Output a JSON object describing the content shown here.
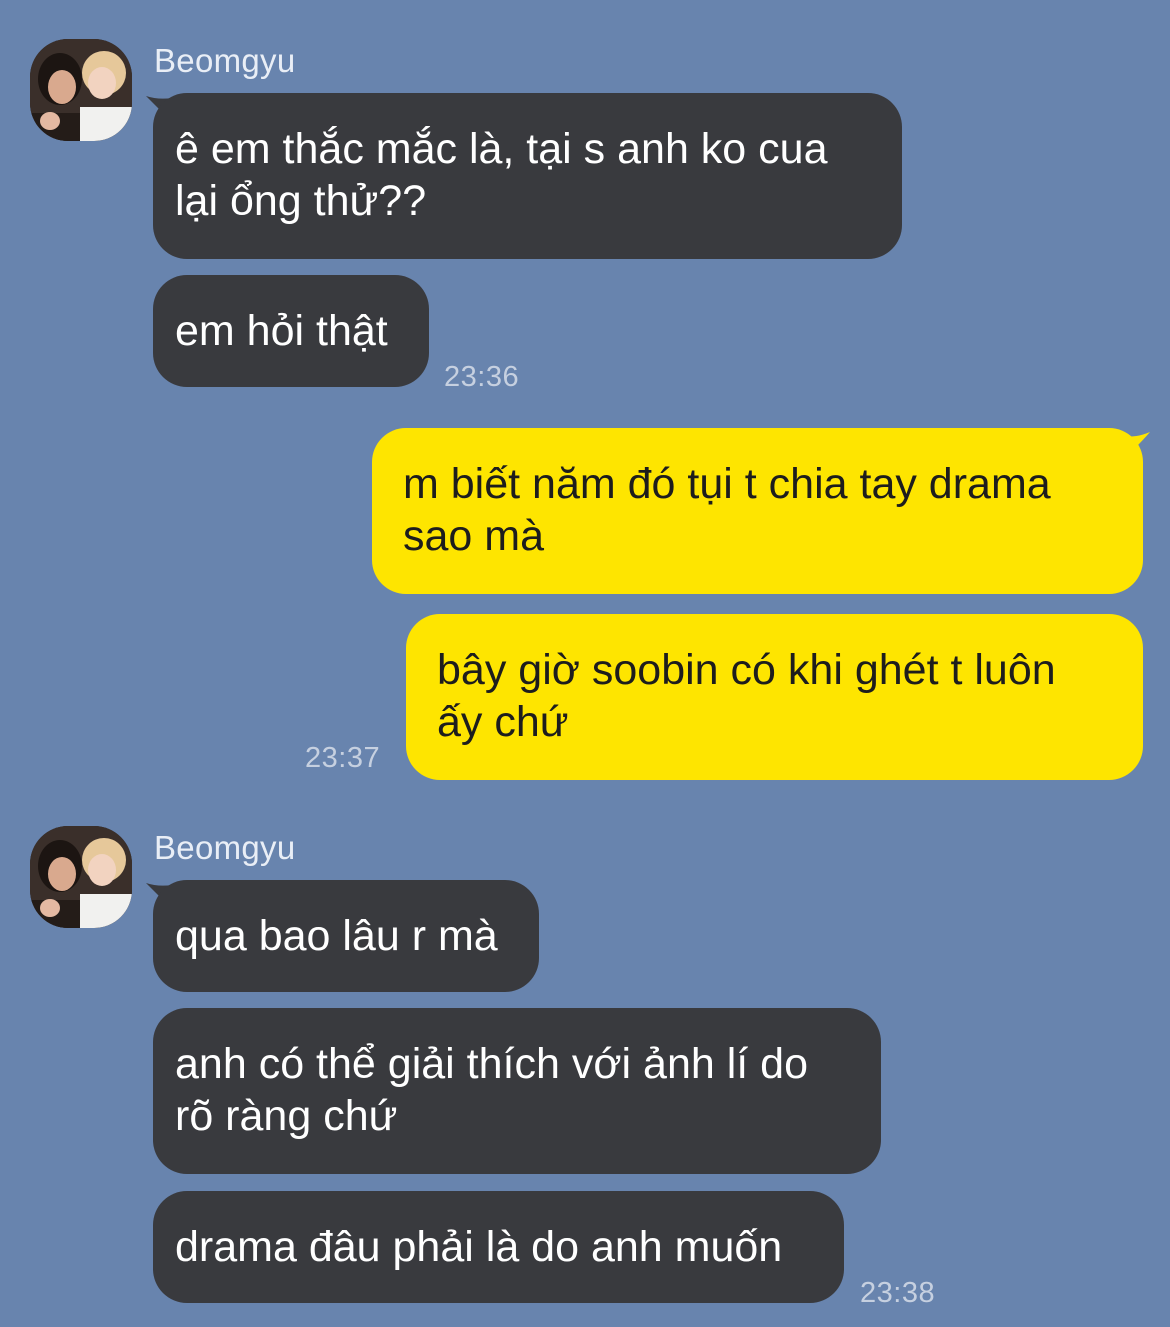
{
  "chat": {
    "groups": [
      {
        "sender": "Beomgyu",
        "avatar_icon": "profile-photo-icon",
        "messages": [
          "ê em thắc mắc là, tại s anh ko cua\nlại ổng thử??",
          "em hỏi thật"
        ],
        "time": "23:36"
      },
      {
        "sender": "me",
        "messages": [
          "m biết năm đó tụi t chia tay drama\nsao mà",
          "bây giờ soobin có khi ghét t luôn\nấy chứ"
        ],
        "time": "23:37"
      },
      {
        "sender": "Beomgyu",
        "avatar_icon": "profile-photo-icon",
        "messages": [
          "qua bao lâu r mà",
          "anh có thể giải thích với ảnh lí do\nrõ ràng chứ",
          "drama đâu phải là do anh muốn"
        ],
        "time": "23:38"
      }
    ]
  },
  "colors": {
    "background": "#6884ae",
    "incoming_bubble": "#393a3e",
    "outgoing_bubble": "#fee500"
  }
}
